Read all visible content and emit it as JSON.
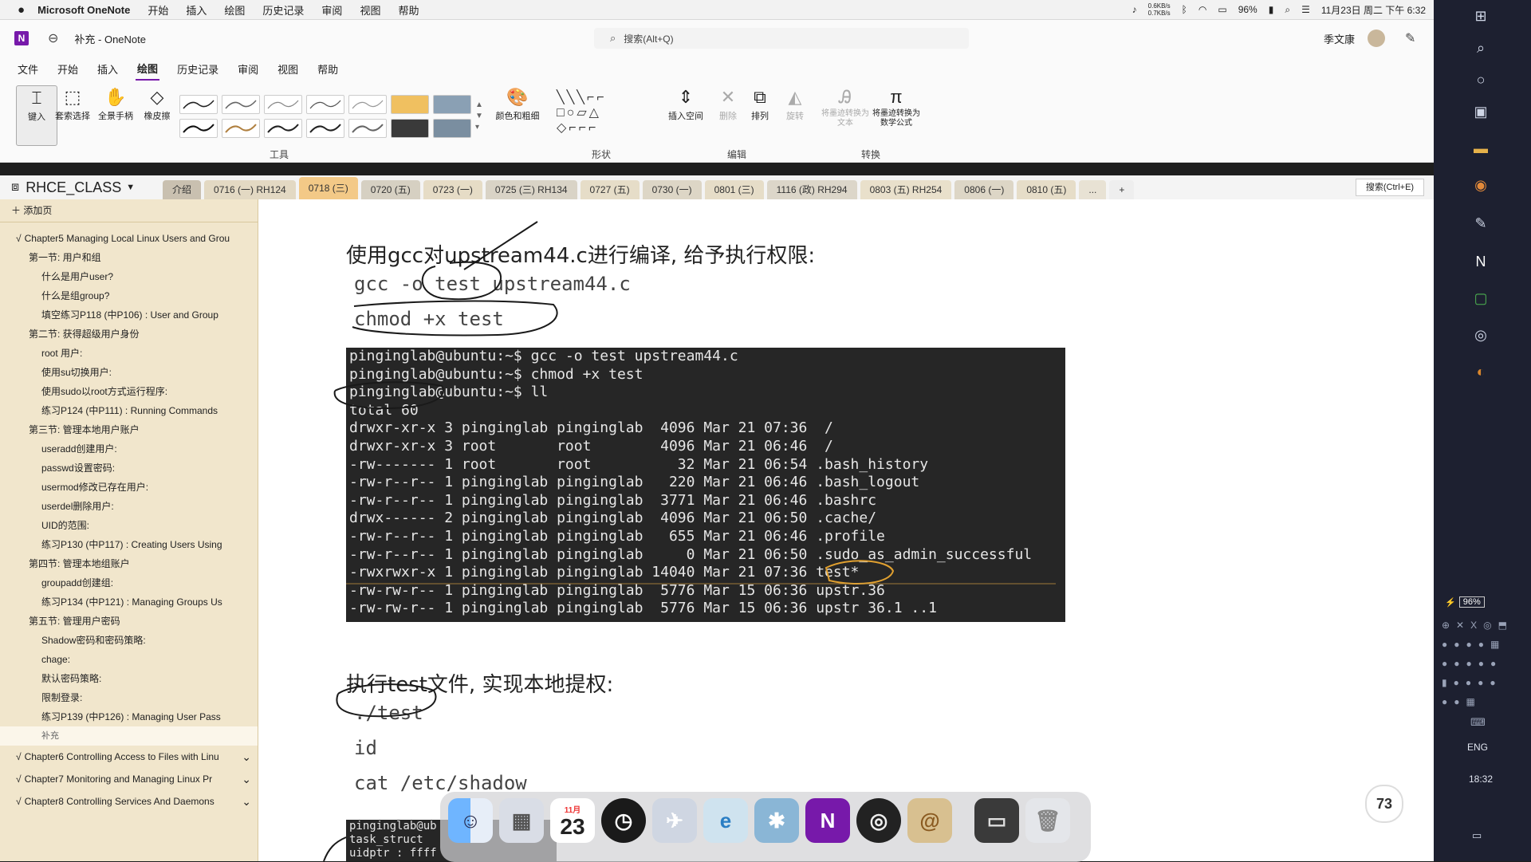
{
  "menubar": {
    "app": "Microsoft OneNote",
    "items": [
      "开始",
      "插入",
      "绘图",
      "历史记录",
      "审阅",
      "视图",
      "帮助"
    ],
    "net_up": "0.6KB/s",
    "net_down": "0.7KB/s",
    "battery": "96%",
    "datetime": "11月23日 周二 下午 6:32"
  },
  "titlebar": {
    "title": "补充 - OneNote",
    "search_placeholder": "搜索(Alt+Q)",
    "user": "季文康"
  },
  "ribbon_tabs": [
    "文件",
    "开始",
    "插入",
    "绘图",
    "历史记录",
    "审阅",
    "视图",
    "帮助"
  ],
  "ribbon_tab_active": 3,
  "ribbon": {
    "type_label": "键入",
    "lasso_label": "套索选择",
    "pan_label": "全景手柄",
    "eraser_label": "橡皮擦",
    "color_label": "颜色和粗细",
    "insert_space_label": "插入空间",
    "delete_label": "删除",
    "arrange_label": "排列",
    "rotate_label": "旋转",
    "ink_to_text_label": "将墨迹转换为文本",
    "ink_to_math_label": "将墨迹转换为数学公式",
    "groups": {
      "tools": "工具",
      "shapes": "形状",
      "edit": "编辑",
      "convert": "转换"
    }
  },
  "notebook": {
    "name": "RHCE_CLASS",
    "sections": [
      {
        "label": "介绍",
        "color": "#c9c0b0"
      },
      {
        "label": "0716 (一) RH124",
        "color": "#e3d9c3"
      },
      {
        "label": "0718 (三)",
        "color": "#f3c987"
      },
      {
        "label": "0720 (五)",
        "color": "#d6d0c2"
      },
      {
        "label": "0723 (一)",
        "color": "#e6dcc6"
      },
      {
        "label": "0725 (三) RH134",
        "color": "#d9d3c6"
      },
      {
        "label": "0727 (五)",
        "color": "#e6ddc8"
      },
      {
        "label": "0730 (一)",
        "color": "#ddd6c6"
      },
      {
        "label": "0801 (三)",
        "color": "#e6ddc8"
      },
      {
        "label": "1116 (政) RH294",
        "color": "#dcd6c9"
      },
      {
        "label": "0803 (五) RH254",
        "color": "#e9e0cb"
      },
      {
        "label": "0806 (一)",
        "color": "#ddd6c6"
      },
      {
        "label": "0810 (五)",
        "color": "#e6ddc8"
      }
    ],
    "more": "...",
    "add": "+",
    "search_label": "搜索(Ctrl+E)"
  },
  "sidebar": {
    "add_page": "添加页",
    "pages": [
      {
        "label": "Chapter5 Managing Local Linux Users and Grou",
        "level": 0,
        "expander": "√"
      },
      {
        "label": "第一节: 用户和组",
        "level": 1
      },
      {
        "label": "什么是用户user?",
        "level": 2
      },
      {
        "label": "什么是组group?",
        "level": 2
      },
      {
        "label": "填空练习P118 (中P106) : User and Group",
        "level": 2
      },
      {
        "label": "第二节: 获得超级用户身份",
        "level": 1
      },
      {
        "label": "root 用户:",
        "level": 2
      },
      {
        "label": "使用su切换用户:",
        "level": 2
      },
      {
        "label": "使用sudo以root方式运行程序:",
        "level": 2
      },
      {
        "label": "练习P124 (中P111) : Running Commands",
        "level": 2
      },
      {
        "label": "第三节: 管理本地用户账户",
        "level": 1
      },
      {
        "label": "useradd创建用户:",
        "level": 2
      },
      {
        "label": "passwd设置密码:",
        "level": 2
      },
      {
        "label": "usermod修改已存在用户:",
        "level": 2
      },
      {
        "label": "userdel删除用户:",
        "level": 2
      },
      {
        "label": "UID的范围:",
        "level": 2
      },
      {
        "label": "练习P130 (中P117) : Creating Users Using",
        "level": 2
      },
      {
        "label": "第四节: 管理本地组账户",
        "level": 1
      },
      {
        "label": "groupadd创建组:",
        "level": 2
      },
      {
        "label": "练习P134 (中P121) : Managing Groups Us",
        "level": 2
      },
      {
        "label": "第五节: 管理用户密码",
        "level": 1
      },
      {
        "label": "Shadow密码和密码策略:",
        "level": 2
      },
      {
        "label": "chage:",
        "level": 2
      },
      {
        "label": "默认密码策略:",
        "level": 2
      },
      {
        "label": "限制登录:",
        "level": 2
      },
      {
        "label": "练习P139 (中P126) : Managing User Pass",
        "level": 2
      },
      {
        "label": "补充",
        "level": 2,
        "selected": true
      }
    ],
    "chapters": [
      "Chapter6 Controlling Access to Files with Linu",
      "Chapter7 Monitoring and Managing Linux Pr",
      "Chapter8 Controlling Services And Daemons"
    ],
    "expander": "√"
  },
  "page": {
    "heading1": "使用gcc对upstream44.c进行编译, 给予执行权限:",
    "cmd1": "gcc -o test upstream44.c",
    "cmd2": "chmod +x test",
    "terminal_lines": [
      "pinginglab@ubuntu:~$ gcc -o test upstream44.c",
      "pinginglab@ubuntu:~$ chmod +x test",
      "pinginglab@ubuntu:~$ ll",
      "total 60",
      "drwxr-xr-x 3 pinginglab pinginglab  4096 Mar 21 07:36  /",
      "drwxr-xr-x 3 root       root        4096 Mar 21 06:46  /",
      "-rw------- 1 root       root          32 Mar 21 06:54 .bash_history",
      "-rw-r--r-- 1 pinginglab pinginglab   220 Mar 21 06:46 .bash_logout",
      "-rw-r--r-- 1 pinginglab pinginglab  3771 Mar 21 06:46 .bashrc",
      "drwx------ 2 pinginglab pinginglab  4096 Mar 21 06:50 .cache/",
      "-rw-r--r-- 1 pinginglab pinginglab   655 Mar 21 06:46 .profile",
      "-rw-r--r-- 1 pinginglab pinginglab     0 Mar 21 06:50 .sudo_as_admin_successful",
      "-rwxrwxr-x 1 pinginglab pinginglab 14040 Mar 21 07:36 test*",
      "-rw-rw-r-- 1 pinginglab pinginglab  5776 Mar 15 06:36 upstr.36",
      "-rw-rw-r-- 1 pinginglab pinginglab  5776 Mar 15 06:36 upstr 36.1 ..1"
    ],
    "heading2": "执行test文件, 实现本地提权:",
    "cmd3": "./test",
    "cmd4": "id",
    "cmd5": "cat /etc/shadow",
    "terminal2_lines": [
      "pinginglab@ub",
      "task_struct",
      "uidptr : ffff"
    ]
  },
  "right_panel": {
    "battery": "96%",
    "lang": "ENG",
    "clock": "18:32",
    "zoom": "73"
  },
  "dock": {
    "calendar_month": "11月",
    "calendar_day": "23",
    "onenote_letter": "N"
  },
  "colors": {
    "accent": "#7719aa",
    "sidebar": "#f1e6cc",
    "selected_section": "#f3c987",
    "ink": "#1a1a1a"
  }
}
